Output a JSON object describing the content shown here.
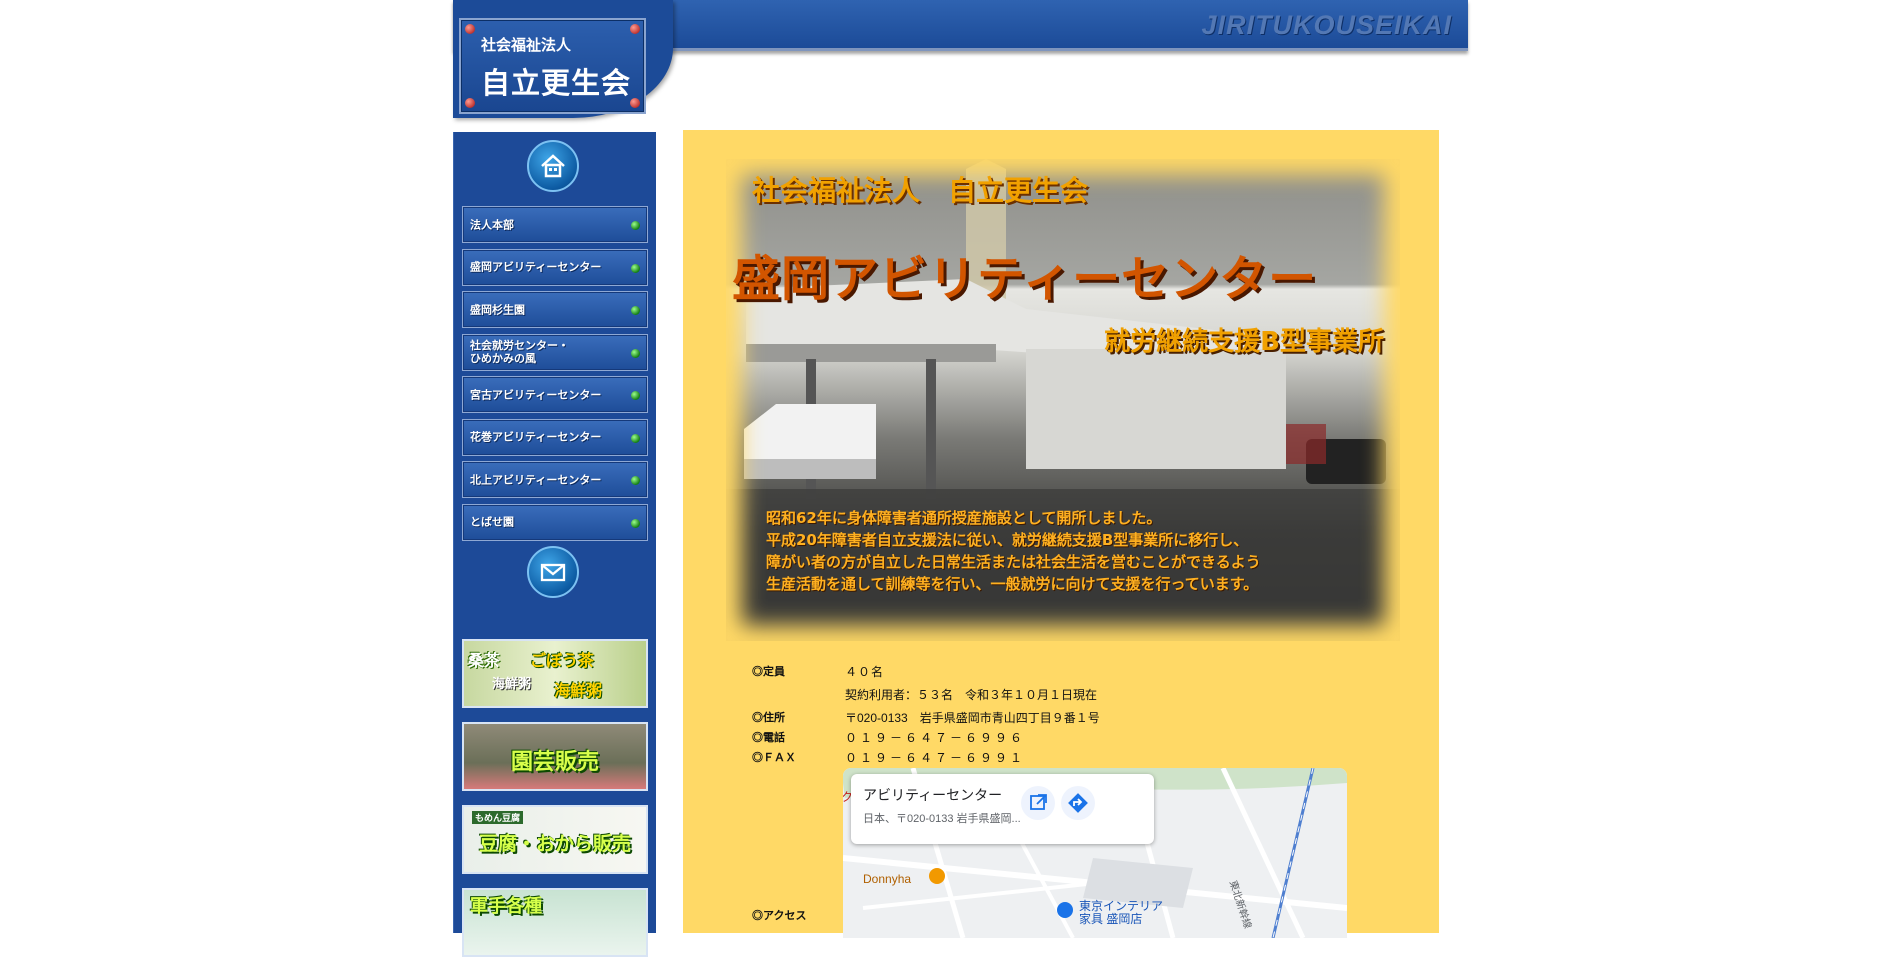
{
  "header": {
    "logo_subtitle": "社会福祉法人",
    "logo_title": "自立更生会",
    "site_tag": "JIRITUKOUSEIKAI"
  },
  "sidebar": {
    "home_icon": "home-icon",
    "mail_icon": "mail-icon",
    "nav_items": [
      {
        "label": "法人本部"
      },
      {
        "label": "盛岡アビリティーセンター"
      },
      {
        "label": "盛岡杉生園"
      },
      {
        "label": "社会就労センター・\nひめかみの風"
      },
      {
        "label": "宮古アビリティーセンター"
      },
      {
        "label": "花巻アビリティーセンター"
      },
      {
        "label": "北上アビリティーセンター"
      },
      {
        "label": "とばせ園"
      }
    ],
    "banners": [
      {
        "text_a": "桑茶",
        "text_b": "ごぼう茶",
        "text_c": "海鮮粥",
        "text_d": "海鮮粥"
      },
      {
        "text": "園芸販売"
      },
      {
        "text_small": "もめん豆腐",
        "text": "豆腐・おから販売"
      },
      {
        "text": "軍手各種"
      }
    ]
  },
  "hero": {
    "org": "社会福祉法人　自立更生会",
    "title": "盛岡アビリティーセンター",
    "subtitle": "就労継続支援B型事業所",
    "description": "昭和62年に身体障害者通所授産施設として開所しました。\n平成20年障害者自立支援法に従い、就労継続支援B型事業所に移行し、\n障がい者の方が自立した日常生活または社会生活を営むことができるよう\n生産活動を通して訓練等を行い、一般就労に向けて支援を行っています。"
  },
  "info": {
    "capacity_label": "◎定員",
    "capacity_value": "４０名",
    "contract_value": "契約利用者：５３名　令和３年１０月１日現在",
    "address_label": "◎住所",
    "address_value": "〒020-0133　岩手県盛岡市青山四丁目９番１号",
    "phone_label": "◎電話",
    "phone_value": "０１９－６４７－６９９６",
    "fax_label": "◎ＦＡＸ",
    "fax_value": "０１９－６４７－６９９１",
    "access_label": "◎アクセス"
  },
  "map": {
    "place_name": "アビリティーセンター",
    "address": "日本、〒020-0133 岩手県盛岡...",
    "open_icon": "open-in-new-icon",
    "directions_icon": "directions-icon",
    "poi_1": "Donnyha",
    "poi_2": "東京インテリア\n家具 盛岡店",
    "rail_label": "東北新幹線",
    "partial_label": "ク"
  }
}
